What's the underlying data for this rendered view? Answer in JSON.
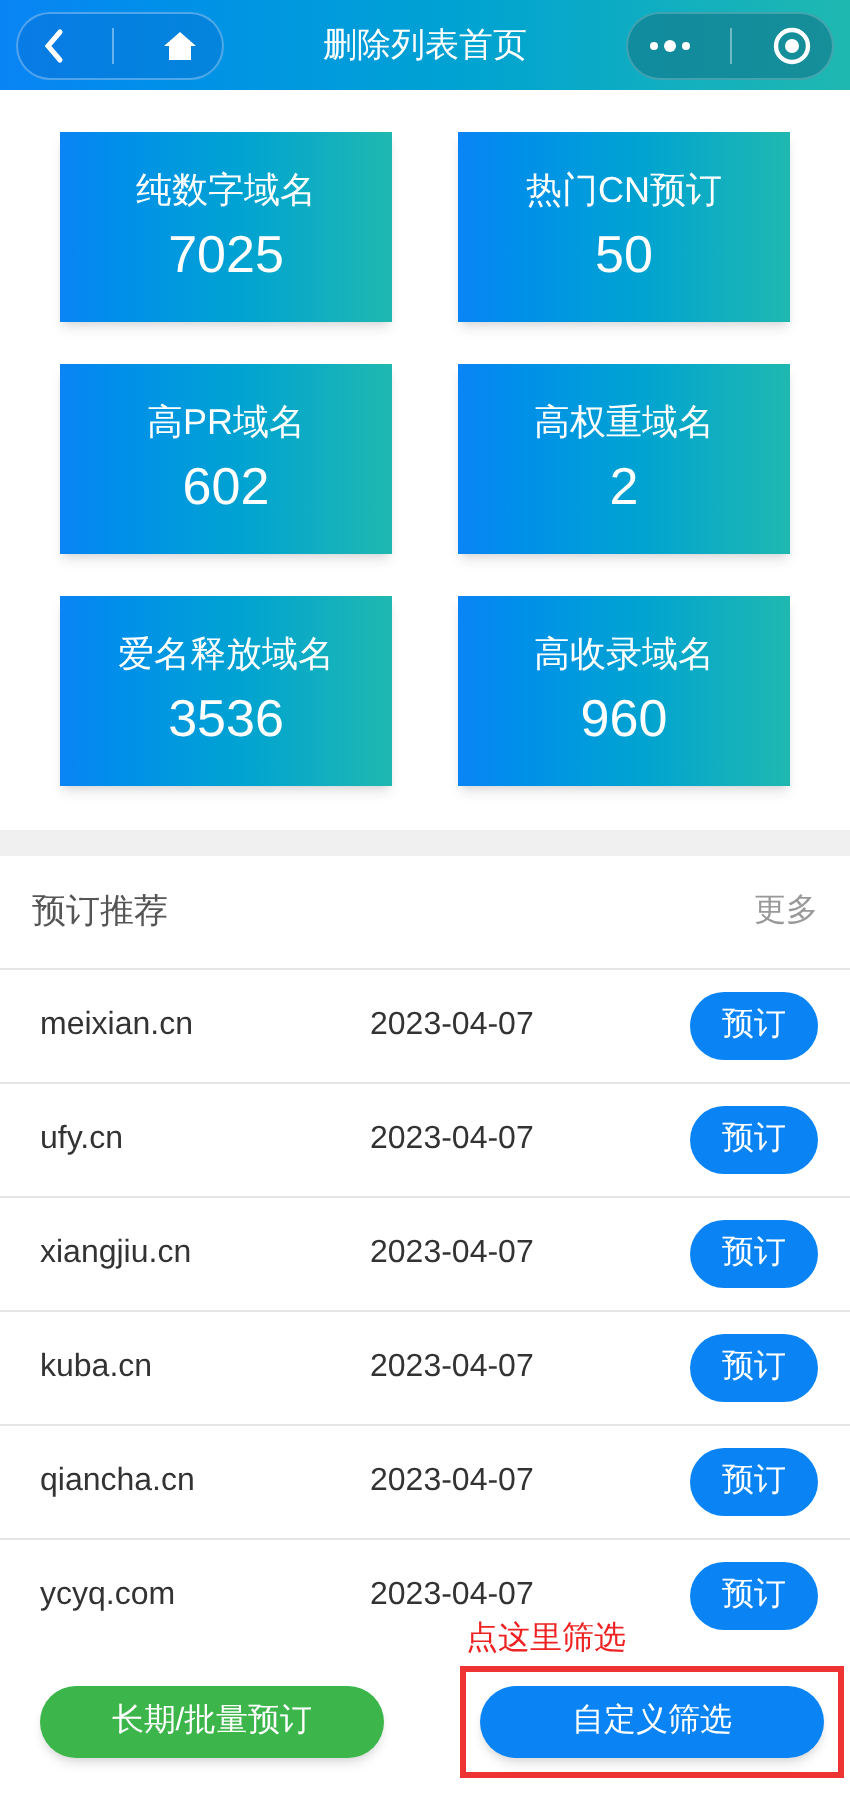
{
  "nav_bar": {
    "title": "删除列表首页"
  },
  "stat_cards": [
    {
      "label": "纯数字域名",
      "value": "7025"
    },
    {
      "label": "热门CN预订",
      "value": "50"
    },
    {
      "label": "高PR域名",
      "value": "602"
    },
    {
      "label": "高权重域名",
      "value": "2"
    },
    {
      "label": "爱名释放域名",
      "value": "3536"
    },
    {
      "label": "高收录域名",
      "value": "960"
    }
  ],
  "recommend": {
    "title": "预订推荐",
    "more": "更多",
    "rows": [
      {
        "domain": "meixian.cn",
        "date": "2023-04-07",
        "action": "预订"
      },
      {
        "domain": "ufy.cn",
        "date": "2023-04-07",
        "action": "预订"
      },
      {
        "domain": "xiangjiu.cn",
        "date": "2023-04-07",
        "action": "预订"
      },
      {
        "domain": "kuba.cn",
        "date": "2023-04-07",
        "action": "预订"
      },
      {
        "domain": "qiancha.cn",
        "date": "2023-04-07",
        "action": "预订"
      },
      {
        "domain": "ycyq.com",
        "date": "2023-04-07",
        "action": "预订"
      }
    ]
  },
  "bottom_bar": {
    "buttons": [
      {
        "label": "长期/批量预订",
        "kind": "green"
      },
      {
        "label": "自定义筛选",
        "kind": "blue",
        "highlighted": true
      }
    ],
    "annotation": "点这里筛选"
  }
}
